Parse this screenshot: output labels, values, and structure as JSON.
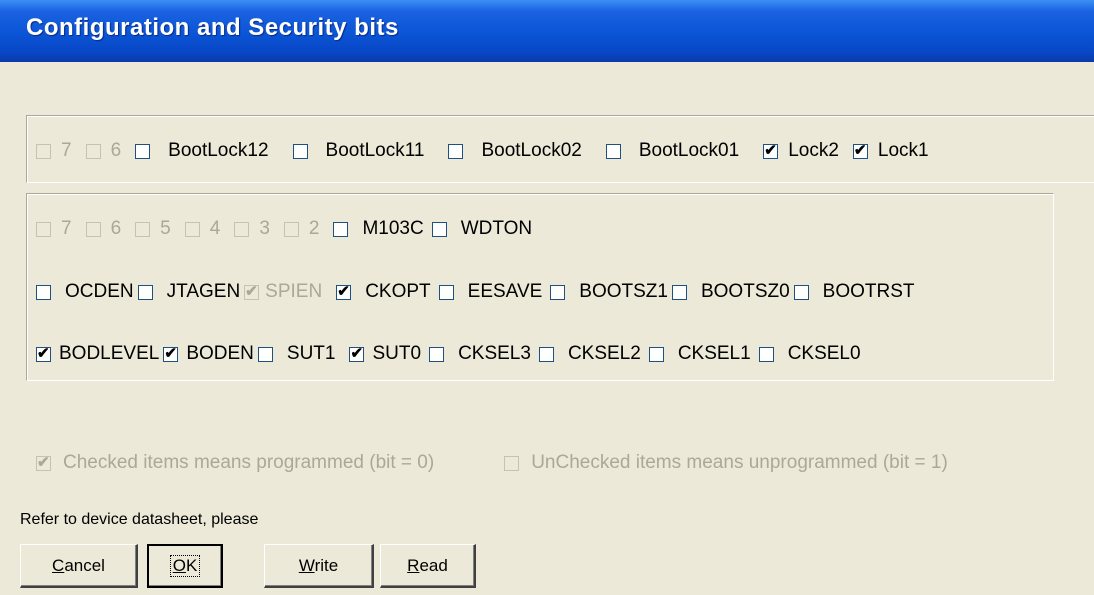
{
  "title": "Configuration and Security bits",
  "lock_row": [
    {
      "label": "7",
      "checked": false,
      "disabled": true
    },
    {
      "label": "6",
      "checked": false,
      "disabled": true
    },
    {
      "label": "BootLock12",
      "checked": false,
      "disabled": false
    },
    {
      "label": "BootLock11",
      "checked": false,
      "disabled": false
    },
    {
      "label": "BootLock02",
      "checked": false,
      "disabled": false
    },
    {
      "label": "BootLock01",
      "checked": false,
      "disabled": false
    },
    {
      "label": "Lock2",
      "checked": true,
      "disabled": false
    },
    {
      "label": "Lock1",
      "checked": true,
      "disabled": false
    }
  ],
  "fuse_rows": [
    [
      {
        "label": "7",
        "checked": false,
        "disabled": true
      },
      {
        "label": "6",
        "checked": false,
        "disabled": true
      },
      {
        "label": "5",
        "checked": false,
        "disabled": true
      },
      {
        "label": "4",
        "checked": false,
        "disabled": true
      },
      {
        "label": "3",
        "checked": false,
        "disabled": true
      },
      {
        "label": "2",
        "checked": false,
        "disabled": true
      },
      {
        "label": "M103C",
        "checked": false,
        "disabled": false
      },
      {
        "label": "WDTON",
        "checked": false,
        "disabled": false
      }
    ],
    [
      {
        "label": "OCDEN",
        "checked": false,
        "disabled": false
      },
      {
        "label": "JTAGEN",
        "checked": false,
        "disabled": false
      },
      {
        "label": "SPIEN",
        "checked": true,
        "disabled": true
      },
      {
        "label": "CKOPT",
        "checked": true,
        "disabled": false
      },
      {
        "label": "EESAVE",
        "checked": false,
        "disabled": false
      },
      {
        "label": "BOOTSZ1",
        "checked": false,
        "disabled": false
      },
      {
        "label": "BOOTSZ0",
        "checked": false,
        "disabled": false
      },
      {
        "label": "BOOTRST",
        "checked": false,
        "disabled": false
      }
    ],
    [
      {
        "label": "BODLEVEL",
        "checked": true,
        "disabled": false
      },
      {
        "label": "BODEN",
        "checked": true,
        "disabled": false
      },
      {
        "label": "SUT1",
        "checked": false,
        "disabled": false
      },
      {
        "label": "SUT0",
        "checked": true,
        "disabled": false
      },
      {
        "label": "CKSEL3",
        "checked": false,
        "disabled": false
      },
      {
        "label": "CKSEL2",
        "checked": false,
        "disabled": false
      },
      {
        "label": "CKSEL1",
        "checked": false,
        "disabled": false
      },
      {
        "label": "CKSEL0",
        "checked": false,
        "disabled": false
      }
    ]
  ],
  "legend": [
    {
      "label": "Checked items means programmed (bit = 0)",
      "checked": true,
      "disabled": true
    },
    {
      "label": "UnChecked items means unprogrammed (bit = 1)",
      "checked": false,
      "disabled": true
    }
  ],
  "note": "Refer to device datasheet, please",
  "buttons": {
    "cancel": {
      "mnemonic": "C",
      "rest": "ancel"
    },
    "ok": {
      "mnemonic": "O",
      "rest": "K"
    },
    "write": {
      "mnemonic": "W",
      "rest": "rite"
    },
    "read": {
      "mnemonic": "R",
      "rest": "ead"
    }
  }
}
